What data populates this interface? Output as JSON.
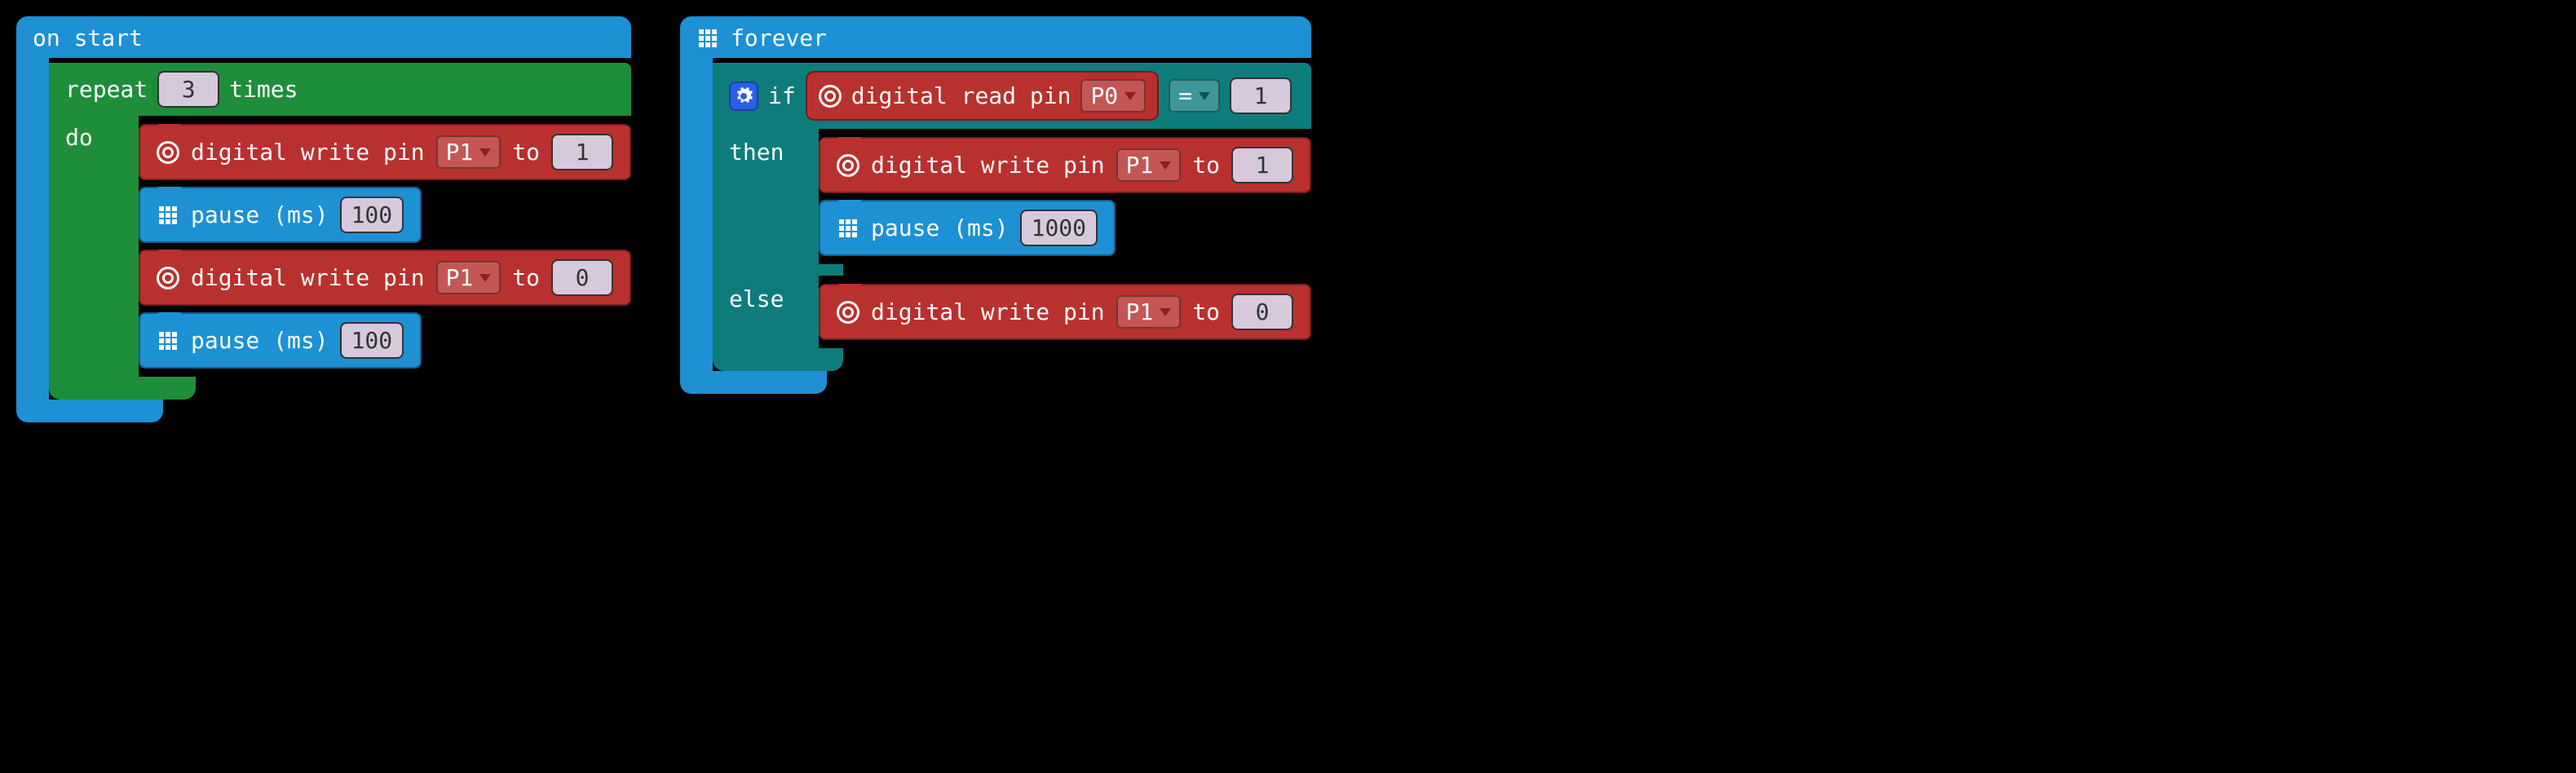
{
  "left": {
    "hat": "on start",
    "repeat_label": "repeat",
    "repeat_count": "3",
    "times_label": "times",
    "do_label": "do",
    "s1": {
      "text": "digital write pin",
      "pin": "P1",
      "to_label": "to",
      "val": "1"
    },
    "s2": {
      "text": "pause (ms)",
      "val": "100"
    },
    "s3": {
      "text": "digital write pin",
      "pin": "P1",
      "to_label": "to",
      "val": "0"
    },
    "s4": {
      "text": "pause (ms)",
      "val": "100"
    }
  },
  "right": {
    "hat": "forever",
    "if_label": "if",
    "then_label": "then",
    "else_label": "else",
    "cond": {
      "text": "digital read pin",
      "pin": "P0",
      "op": "=",
      "val": "1"
    },
    "t1": {
      "text": "digital write pin",
      "pin": "P1",
      "to_label": "to",
      "val": "1"
    },
    "t2": {
      "text": "pause (ms)",
      "val": "1000"
    },
    "e1": {
      "text": "digital write pin",
      "pin": "P1",
      "to_label": "to",
      "val": "0"
    }
  }
}
